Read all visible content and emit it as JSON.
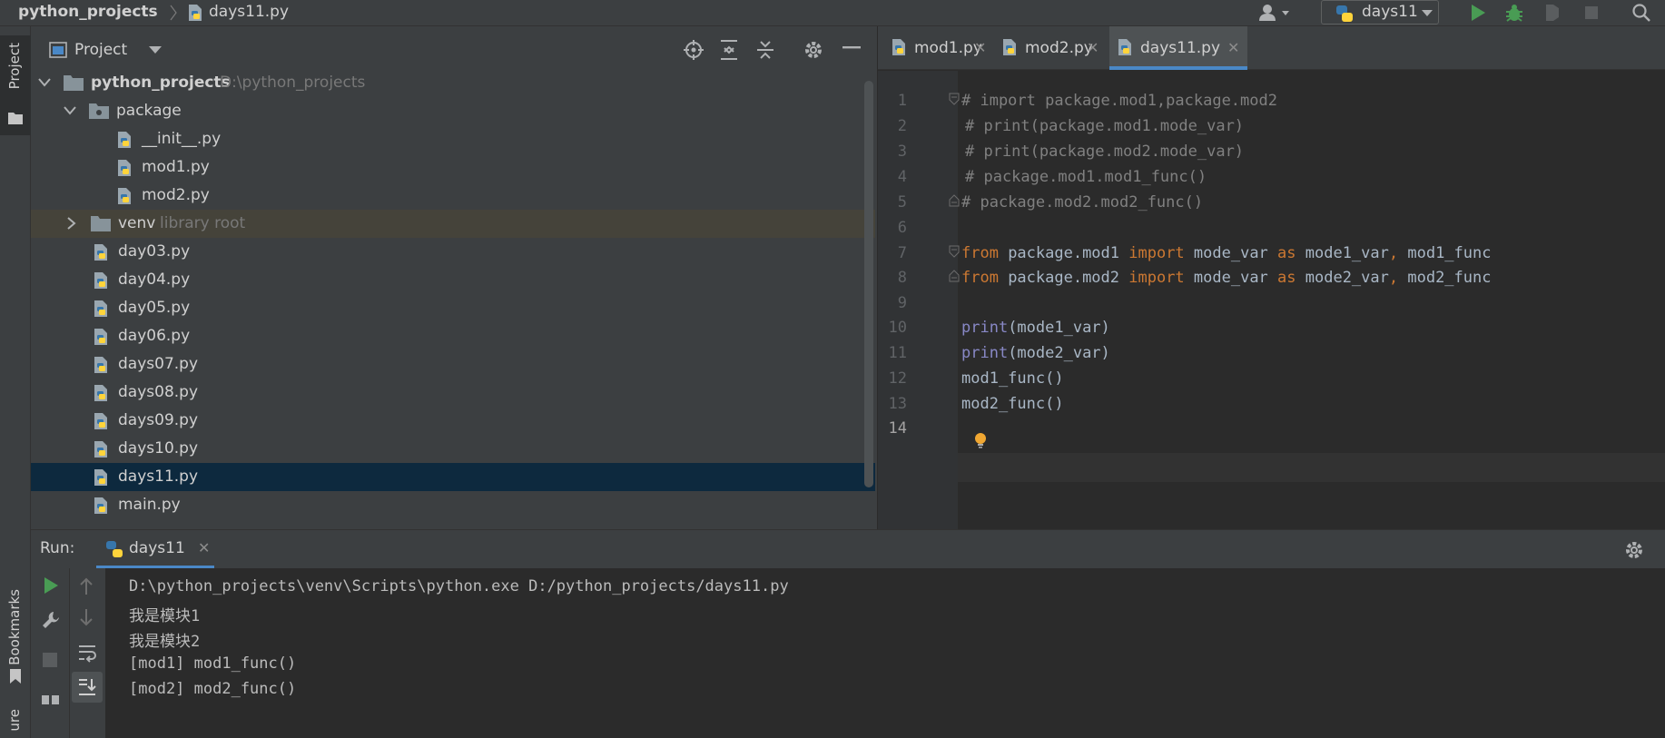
{
  "navbar": {
    "project": "python_projects",
    "file": "days11.py",
    "run_config": "days11"
  },
  "project_panel": {
    "title": "Project",
    "tree": [
      {
        "label": "python_projects",
        "hint": "D:\\python_projects",
        "kind": "root-folder",
        "expanded": true
      },
      {
        "label": "package",
        "kind": "package-folder",
        "expanded": true
      },
      {
        "label": "__init__.py",
        "kind": "python-file"
      },
      {
        "label": "mod1.py",
        "kind": "python-file"
      },
      {
        "label": "mod2.py",
        "kind": "python-file"
      },
      {
        "label": "venv",
        "hint": "library root",
        "kind": "folder",
        "expanded": false
      },
      {
        "label": "day03.py",
        "kind": "python-file"
      },
      {
        "label": "day04.py",
        "kind": "python-file"
      },
      {
        "label": "day05.py",
        "kind": "python-file"
      },
      {
        "label": "day06.py",
        "kind": "python-file"
      },
      {
        "label": "days07.py",
        "kind": "python-file"
      },
      {
        "label": "days08.py",
        "kind": "python-file"
      },
      {
        "label": "days09.py",
        "kind": "python-file"
      },
      {
        "label": "days10.py",
        "kind": "python-file"
      },
      {
        "label": "days11.py",
        "kind": "python-file",
        "selected": true
      },
      {
        "label": "main.py",
        "kind": "python-file"
      }
    ]
  },
  "editor": {
    "tabs": [
      {
        "label": "mod1.py",
        "active": false
      },
      {
        "label": "mod2.py",
        "active": false
      },
      {
        "label": "days11.py",
        "active": true
      }
    ],
    "line_numbers": [
      "1",
      "2",
      "3",
      "4",
      "5",
      "6",
      "7",
      "8",
      "9",
      "10",
      "11",
      "12",
      "13",
      "14"
    ],
    "current_line": "14",
    "code": {
      "l1": "# import package.mod1,package.mod2",
      "l2": "# print(package.mod1.mode_var)",
      "l3": "# print(package.mod2.mode_var)",
      "l4": "# package.mod1.mod1_func()",
      "l5": "# package.mod2.mod2_func()",
      "l7": {
        "from": "from",
        "mod": " package.mod1 ",
        "import": "import",
        "a": " mode_var ",
        "as": "as",
        "b": " mode1_var",
        "comma": ",",
        "c": " mod1_func"
      },
      "l8": {
        "from": "from",
        "mod": " package.mod2 ",
        "import": "import",
        "a": " mode_var ",
        "as": "as",
        "b": " mode2_var",
        "comma": ",",
        "c": " mod2_func"
      },
      "l10": {
        "fn": "print",
        "args": "(mode1_var)"
      },
      "l11": {
        "fn": "print",
        "args": "(mode2_var)"
      },
      "l12": "mod1_func()",
      "l13": "mod2_func()"
    }
  },
  "run": {
    "label": "Run:",
    "tab": "days11",
    "output": [
      "D:\\python_projects\\venv\\Scripts\\python.exe D:/python_projects/days11.py",
      "我是模块1",
      "我是模块2",
      "[mod1] mod1_func()",
      "[mod2] mod2_func()"
    ]
  },
  "side_strip": {
    "project": "Project",
    "bookmarks": "Bookmarks",
    "structure": "ure"
  },
  "colors": {
    "keyword": "#cc7832",
    "builtin": "#8888c6",
    "comment": "#808080",
    "selection": "#0d293e",
    "accent": "#4a88c7"
  }
}
